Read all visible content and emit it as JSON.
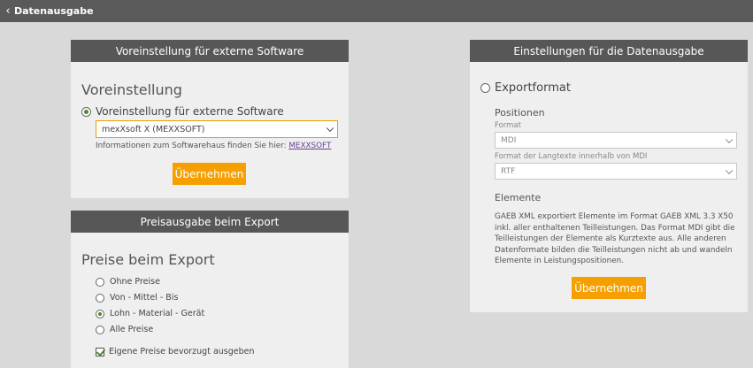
{
  "topbar": {
    "back_icon": "chevron-left-icon",
    "title": "Datenausgabe"
  },
  "preset_panel": {
    "header": "Voreinstellung für externe Software",
    "section_title": "Voreinstellung",
    "radio_label": "Voreinstellung für externe Software",
    "radio_selected": true,
    "select_value": "mexXsoft X (MEXXSOFT)",
    "info_text": "Informationen zum Softwarehaus finden Sie hier:",
    "info_link": "MEXXSOFT",
    "apply_label": "Übernehmen"
  },
  "price_panel": {
    "header": "Preisausgabe beim Export",
    "section_title": "Preise beim Export",
    "options": [
      {
        "label": "Ohne Preise",
        "selected": false
      },
      {
        "label": "Von - Mittel - Bis",
        "selected": false
      },
      {
        "label": "Lohn - Material - Gerät",
        "selected": true
      },
      {
        "label": "Alle Preise",
        "selected": false
      }
    ],
    "checkbox_label": "Eigene Preise bevorzugt ausgeben",
    "checkbox_checked": true
  },
  "export_panel": {
    "header": "Einstellungen für die Datenausgabe",
    "radio_label": "Exportformat",
    "radio_selected": false,
    "positions_title": "Positionen",
    "format_label": "Format",
    "format_value": "MDI",
    "longtext_label": "Format der Langtexte innerhalb von MDI",
    "longtext_value": "RTF",
    "elements_title": "Elemente",
    "elements_text": "GAEB XML exportiert Elemente im Format GAEB XML 3.3 X50 inkl. aller enthaltenen Teilleistungen. Das Format MDI gibt die Teilleistungen der Elemente als Kurztexte aus. Alle anderen Datenformate bilden die Teilleistungen nicht ab und wandeln Elemente in Leistungspositionen.",
    "apply_label": "Übernehmen"
  },
  "colors": {
    "accent": "#f5a000",
    "header_bg": "#575757",
    "topbar_bg": "#5a5a5a",
    "radio_fill": "#4a8a2a"
  }
}
